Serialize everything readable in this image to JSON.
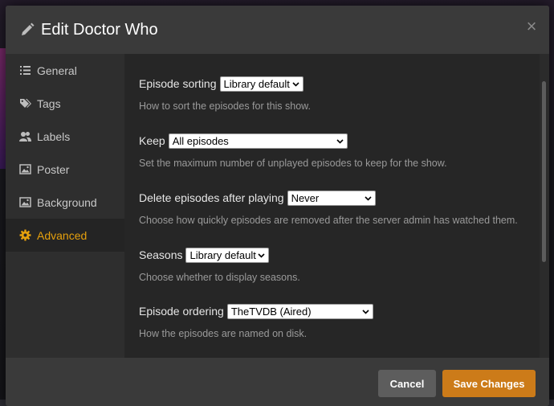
{
  "modal": {
    "title": "Edit Doctor Who",
    "close_glyph": "×"
  },
  "sidebar": {
    "items": [
      {
        "label": "General",
        "icon": "list-icon",
        "active": false
      },
      {
        "label": "Tags",
        "icon": "tags-icon",
        "active": false
      },
      {
        "label": "Labels",
        "icon": "users-icon",
        "active": false
      },
      {
        "label": "Poster",
        "icon": "image-icon",
        "active": false
      },
      {
        "label": "Background",
        "icon": "image-icon",
        "active": false
      },
      {
        "label": "Advanced",
        "icon": "gear-icon",
        "active": true
      }
    ]
  },
  "settings": {
    "episode_sorting": {
      "label": "Episode sorting",
      "value": "Library default",
      "help": "How to sort the episodes for this show."
    },
    "keep": {
      "label": "Keep",
      "value": "All episodes",
      "help": "Set the maximum number of unplayed episodes to keep for the show."
    },
    "delete_after_playing": {
      "label": "Delete episodes after playing",
      "value": "Never",
      "help": "Choose how quickly episodes are removed after the server admin has watched them."
    },
    "seasons": {
      "label": "Seasons",
      "value": "Library default",
      "help": "Choose whether to display seasons."
    },
    "episode_ordering": {
      "label": "Episode ordering",
      "value": "TheTVDB (Aired)",
      "help": "How the episodes are named on disk."
    }
  },
  "footer": {
    "cancel_label": "Cancel",
    "save_label": "Save Changes"
  },
  "colors": {
    "accent": "#e5a00d",
    "save_button": "#cc7b19",
    "cancel_button": "#5d5d5d"
  }
}
